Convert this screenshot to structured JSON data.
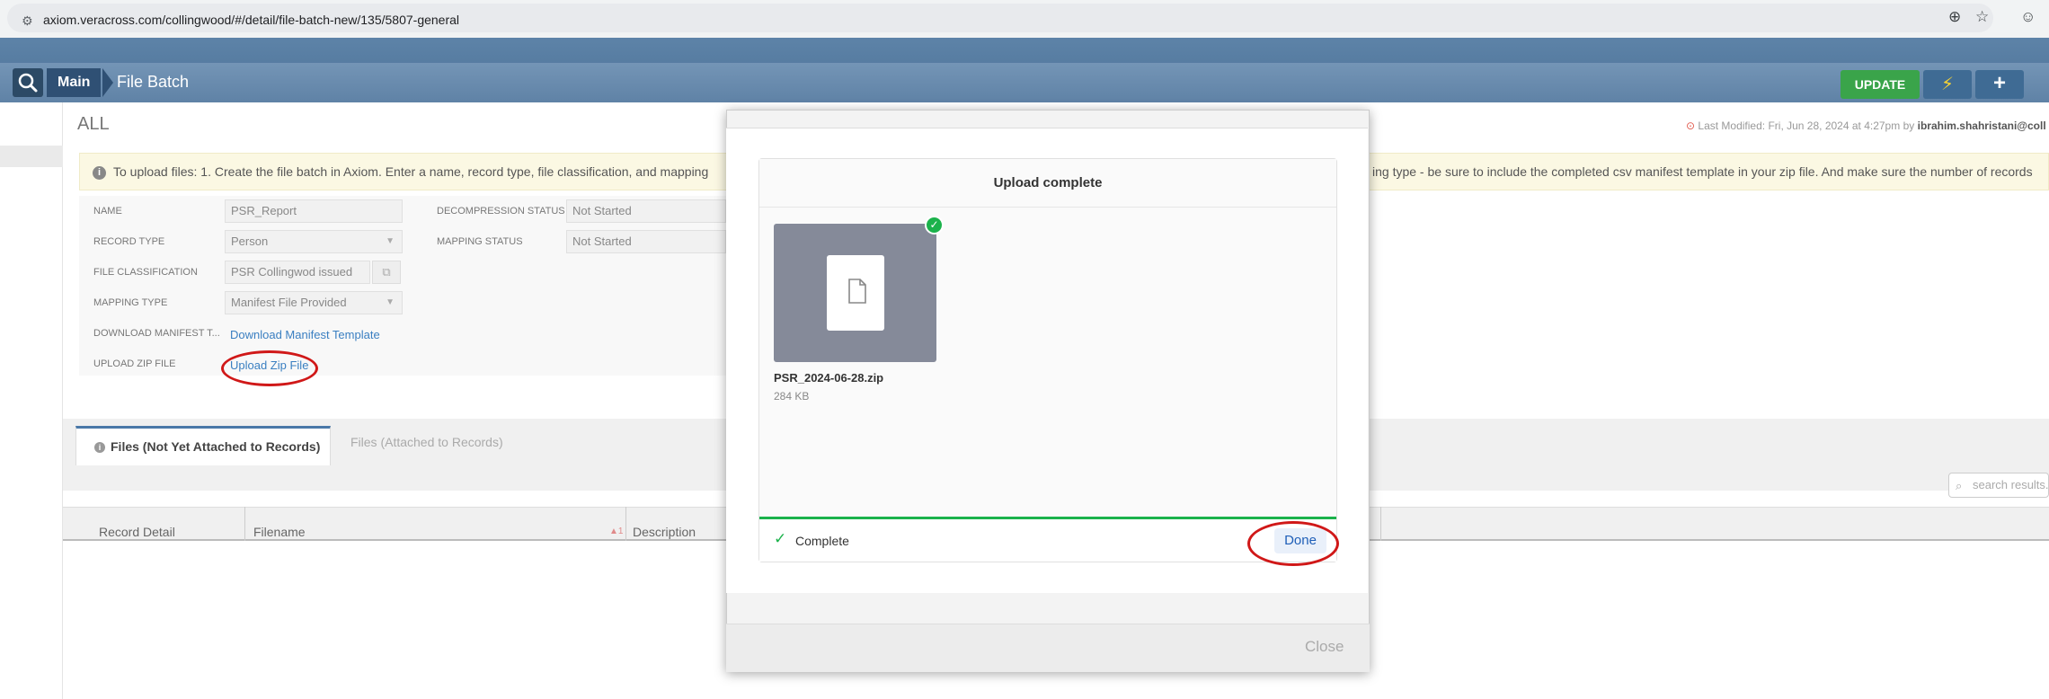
{
  "browser": {
    "url": "axiom.veracross.com/collingwood/#/detail/file-batch-new/135/5807-general"
  },
  "header": {
    "breadcrumb_main": "Main",
    "page_title": "File Batch",
    "update_label": "UPDATE"
  },
  "record": {
    "title": "ALL",
    "last_modified_label": "Last Modified:",
    "last_modified_date": "Fri, Jun 28, 2024 at 4:27pm",
    "by_label": "by",
    "last_modified_user": "ibrahim.shahristani@coll"
  },
  "alert": {
    "text": "To upload files: 1. Create the file batch in Axiom. Enter a name, record type, file classification, and mapping",
    "text_right": "ing type - be sure to include the completed csv manifest template in your zip file. And make sure the number of records"
  },
  "form": {
    "name_label": "NAME",
    "name_value": "PSR_Report",
    "record_type_label": "RECORD TYPE",
    "record_type_value": "Person",
    "file_classification_label": "FILE CLASSIFICATION",
    "file_classification_value": "PSR Collingwod issued",
    "mapping_type_label": "MAPPING TYPE",
    "mapping_type_value": "Manifest File Provided",
    "download_manifest_label": "DOWNLOAD MANIFEST T...",
    "download_manifest_link": "Download Manifest Template",
    "upload_zip_label": "UPLOAD ZIP FILE",
    "upload_zip_link": "Upload Zip File",
    "decompression_status_label": "DECOMPRESSION STATUS",
    "decompression_status_value": "Not Started",
    "mapping_status_label": "MAPPING STATUS",
    "mapping_status_value": "Not Started"
  },
  "tabs": {
    "active": "Files (Not Yet Attached to Records)",
    "inactive": "Files (Attached to Records)"
  },
  "table": {
    "search_placeholder": "search results...",
    "columns": [
      "Record Detail",
      "Filename",
      "Description"
    ],
    "sort_indicator": "▲1"
  },
  "modal": {
    "header": "Upload complete",
    "file_name": "PSR_2024-06-28.zip",
    "file_size": "284 KB",
    "status": "Complete",
    "done_label": "Done",
    "close_label": "Close",
    "progress": 1.0
  },
  "colors": {
    "accent_green": "#1bb24b",
    "update_green": "#3aa44a",
    "header_blue": "#4d7297",
    "annotation_red": "#d01818"
  }
}
